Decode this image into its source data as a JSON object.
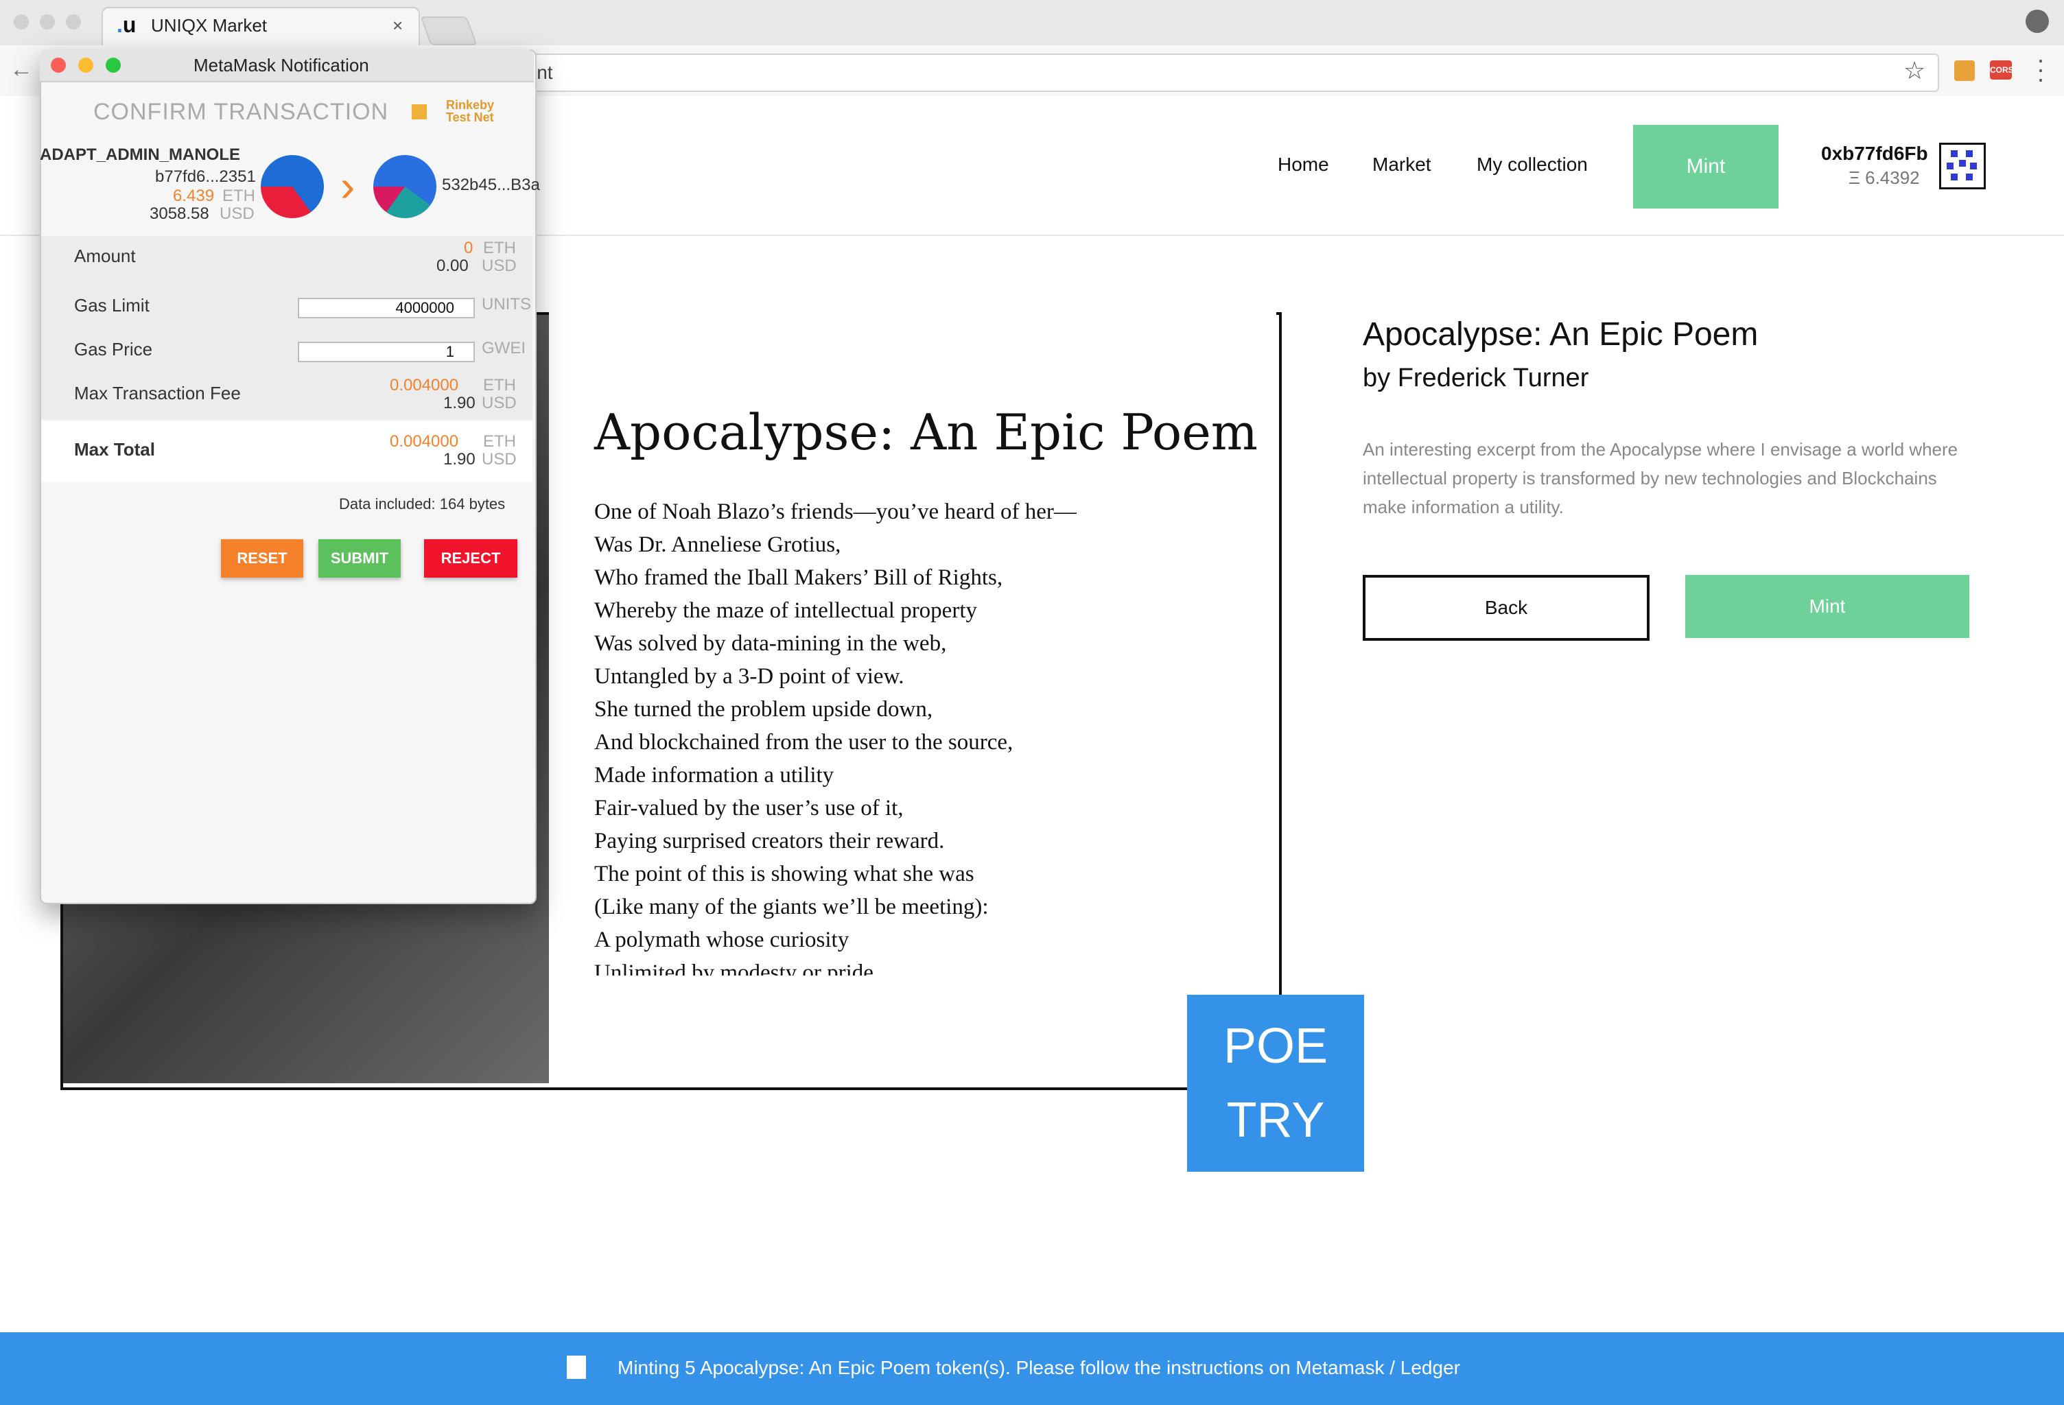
{
  "browser": {
    "tab_title": "UNIQX Market",
    "tab_logo": "u",
    "tab_close": "×",
    "url_fragment": "int",
    "back_icon": "←",
    "star_icon": "☆",
    "ext_badge": "CORS"
  },
  "nav": {
    "home": "Home",
    "market": "Market",
    "collection": "My collection",
    "mint": "Mint"
  },
  "wallet": {
    "address": "0xb77fd6Fb",
    "balance": "Ξ 6.4392"
  },
  "poem": {
    "title": "Apocalypse: An Epic Poem",
    "lines": [
      "One of Noah Blazo’s friends—you’ve heard of her—",
      "Was Dr. Anneliese Grotius,",
      "Who framed the Iball Makers’ Bill of Rights,",
      "Whereby the maze of intellectual property",
      "Was solved by data-mining in the web,",
      "Untangled by a 3-D point of view.",
      "She turned the problem upside down,",
      "And blockchained from the user to the source,",
      "Made information a utility",
      "Fair-valued by the user’s use of it,",
      "Paying surprised creators their reward.",
      "The point of this is showing what she was",
      "(Like many of the giants we’ll be meeting):",
      "A polymath whose curiosity",
      "Unlimited by modesty or pride"
    ]
  },
  "badge": {
    "line1": "POE",
    "line2": "TRY"
  },
  "detail": {
    "title": "Apocalypse: An Epic Poem",
    "author": "by Frederick Turner",
    "description": "An interesting excerpt from the Apocalypse where I envisage a world where intellectual property is transformed by new technologies and Blockchains make information a utility.",
    "back_label": "Back",
    "mint_label": "Mint"
  },
  "banner": {
    "text": "Minting 5 Apocalypse: An Epic Poem token(s). Please follow the instructions on Metamask / Ledger"
  },
  "metamask": {
    "window_title": "MetaMask Notification",
    "heading": "CONFIRM TRANSACTION",
    "network_line1": "Rinkeby",
    "network_line2": "Test Net",
    "account_name": "ADAPT_ADMIN_MANOLE",
    "from_address": "b77fd6...2351",
    "from_eth": "6.439",
    "from_usd": "3058.58",
    "to_address": "532b45...B3a",
    "unit_eth": "ETH",
    "unit_usd": "USD",
    "amount_label": "Amount",
    "amount_eth": "0",
    "amount_usd": "0.00",
    "gas_limit_label": "Gas Limit",
    "gas_limit_value": "4000000",
    "gas_limit_unit": "UNITS",
    "gas_price_label": "Gas Price",
    "gas_price_value": "1",
    "gas_price_unit": "GWEI",
    "max_fee_label": "Max Transaction Fee",
    "max_fee_eth": "0.004000",
    "max_fee_usd": "1.90",
    "max_total_label": "Max Total",
    "max_total_eth": "0.004000",
    "max_total_usd": "1.90",
    "data_included": "Data included: 164 bytes",
    "reset_label": "RESET",
    "submit_label": "SUBMIT",
    "reject_label": "REJECT"
  },
  "colors": {
    "accent_green": "#6fd19a",
    "accent_blue": "#3493e8",
    "mm_orange": "#f5822b",
    "reset": "#f5822b",
    "submit": "#5cc05c",
    "reject": "#f0132b"
  }
}
